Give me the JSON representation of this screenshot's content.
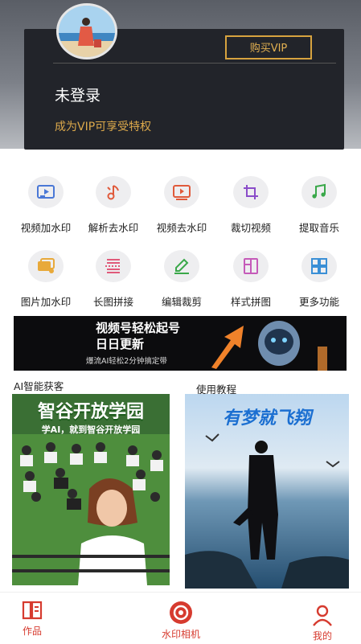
{
  "header": {
    "vip_button": "购买VIP",
    "login_status": "未登录",
    "vip_tip": "成为VIP可享受特权"
  },
  "tools": [
    {
      "label": "视频加水印",
      "icon": "video-watermark-icon"
    },
    {
      "label": "解析去水印",
      "icon": "parse-remove-watermark-icon"
    },
    {
      "label": "视频去水印",
      "icon": "video-remove-watermark-icon"
    },
    {
      "label": "裁切视频",
      "icon": "crop-icon"
    },
    {
      "label": "提取音乐",
      "icon": "music-note-icon"
    },
    {
      "label": "图片加水印",
      "icon": "image-watermark-icon"
    },
    {
      "label": "长图拼接",
      "icon": "long-image-stitch-icon"
    },
    {
      "label": "编辑裁剪",
      "icon": "pencil-icon"
    },
    {
      "label": "样式拼图",
      "icon": "collage-icon"
    },
    {
      "label": "更多功能",
      "icon": "grid-more-icon"
    }
  ],
  "banner": {
    "line1": "视频号轻松起号",
    "line2": "日日更新",
    "line3": "爆流AI轻松2分钟搞定带"
  },
  "sections": {
    "left_label": "AI智能获客",
    "right_label": "使用教程"
  },
  "promo_left": {
    "title": "智谷开放学园",
    "subtitle": "学AI，就到智谷开放学园"
  },
  "promo_right": {
    "title": "有梦就飞翔"
  },
  "tabbar": {
    "works": "作品",
    "camera": "水印相机",
    "mine": "我的"
  },
  "colors": {
    "accent": "#d63b2f",
    "gold": "#dca94b",
    "card": "#22242a",
    "icon_bg": "#eeeef0"
  }
}
